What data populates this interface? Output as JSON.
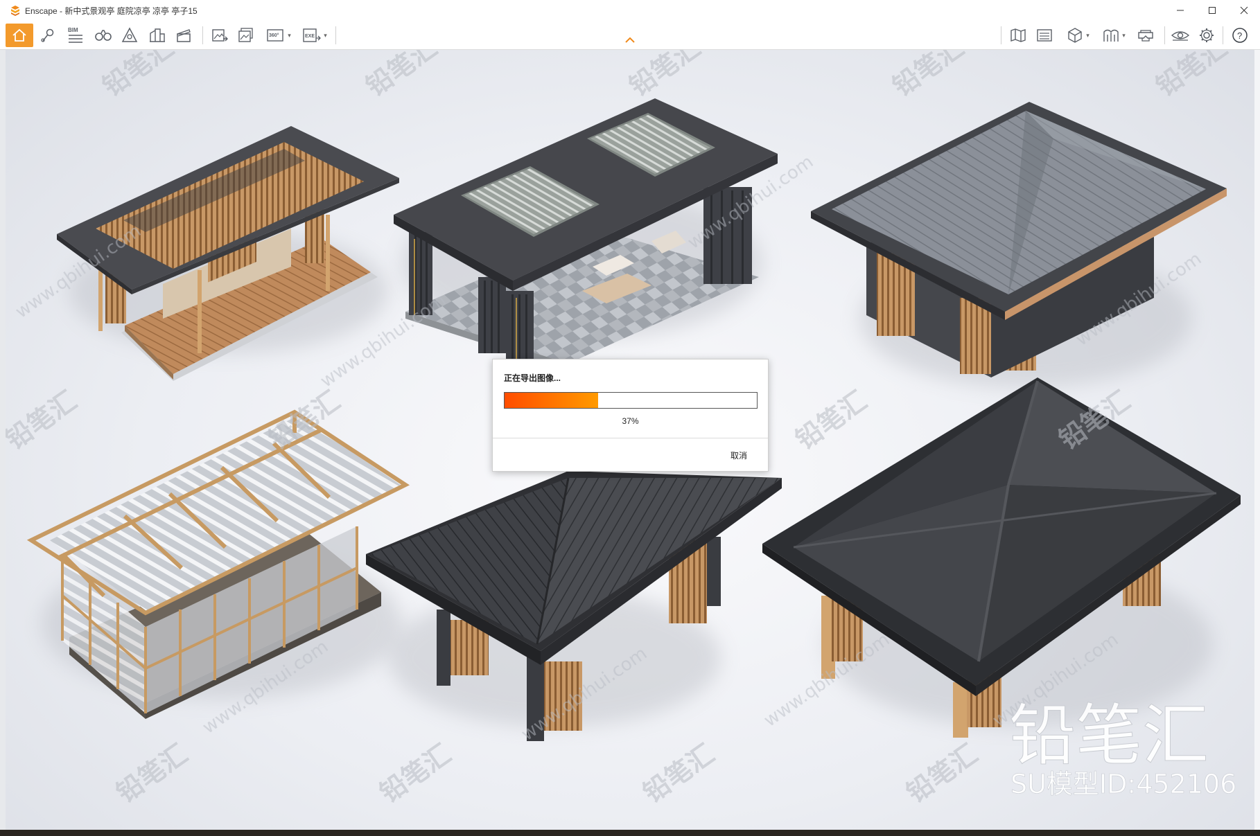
{
  "window": {
    "title": "Enscape - 新中式景观亭 庭院凉亭 凉亭 亭子15",
    "controls": [
      "minimize",
      "maximize",
      "close"
    ]
  },
  "toolbar": {
    "left_tools": [
      {
        "name": "home",
        "active": true
      },
      {
        "name": "map-marker"
      },
      {
        "name": "bim",
        "label": "BIM"
      },
      {
        "name": "binoculars"
      },
      {
        "name": "sun-triangle"
      },
      {
        "name": "assets"
      },
      {
        "name": "clapboard"
      },
      {
        "name": "export-image"
      },
      {
        "name": "batch-render"
      },
      {
        "name": "panorama",
        "label": "360°"
      },
      {
        "name": "export-exe",
        "label": "EXE"
      }
    ],
    "right_tools": [
      {
        "name": "map"
      },
      {
        "name": "screenshot-view"
      },
      {
        "name": "cube-view"
      },
      {
        "name": "column-view"
      },
      {
        "name": "vr-headset"
      },
      {
        "name": "visibility-eye"
      },
      {
        "name": "settings"
      },
      {
        "name": "help",
        "label": "?"
      }
    ],
    "accent_color": "#f39a2c"
  },
  "export_dialog": {
    "title": "正在导出图像...",
    "progress_percent": 37,
    "progress_label": "37%",
    "cancel_label": "取消",
    "progress_colors": [
      "#ff4d00",
      "#ff9a00"
    ]
  },
  "watermark": {
    "brand_big": "铅笔汇",
    "model_id": "SU模型ID:452106",
    "repeat_cn": "铅笔汇",
    "repeat_url": "www.qbihui.com"
  }
}
